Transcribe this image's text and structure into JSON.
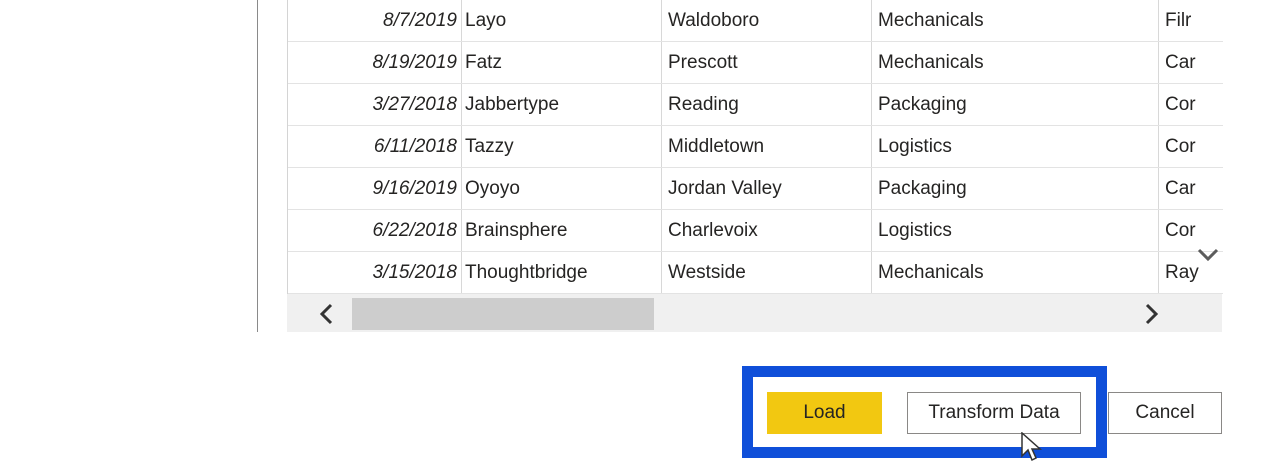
{
  "table": {
    "rows": [
      {
        "date": "8/7/2019",
        "name": "Layo",
        "city": "Waldoboro",
        "category": "Mechanicals",
        "more": "Filr"
      },
      {
        "date": "8/19/2019",
        "name": "Fatz",
        "city": "Prescott",
        "category": "Mechanicals",
        "more": "Car"
      },
      {
        "date": "3/27/2018",
        "name": "Jabbertype",
        "city": "Reading",
        "category": "Packaging",
        "more": "Cor"
      },
      {
        "date": "6/11/2018",
        "name": "Tazzy",
        "city": "Middletown",
        "category": "Logistics",
        "more": "Cor"
      },
      {
        "date": "9/16/2019",
        "name": "Oyoyo",
        "city": "Jordan Valley",
        "category": "Packaging",
        "more": "Car"
      },
      {
        "date": "6/22/2018",
        "name": "Brainsphere",
        "city": "Charlevoix",
        "category": "Logistics",
        "more": "Cor"
      },
      {
        "date": "3/15/2018",
        "name": "Thoughtbridge",
        "city": "Westside",
        "category": "Mechanicals",
        "more": "Ray"
      }
    ]
  },
  "buttons": {
    "load_label": "Load",
    "transform_label": "Transform Data",
    "cancel_label": "Cancel"
  },
  "colors": {
    "accent_yellow": "#f2c811",
    "highlight_blue": "#0f4fd9"
  },
  "icons": {
    "scroll_down": "chevron-down-icon",
    "scroll_left": "chevron-left-icon",
    "scroll_right": "chevron-right-icon",
    "cursor": "mouse-pointer-icon"
  }
}
